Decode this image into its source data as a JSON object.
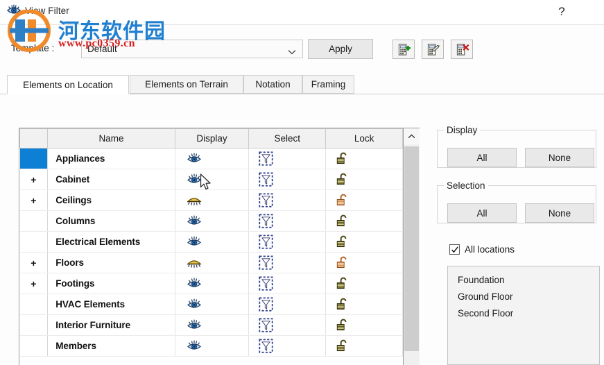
{
  "window": {
    "title": "View Filter",
    "help_label": "?",
    "title_icon": "eye-icon"
  },
  "watermark": {
    "cn_text": "河东软件园",
    "url_text": "www.pc0359.cn"
  },
  "template_row": {
    "label": "Template :",
    "value": "Default",
    "apply_label": "Apply",
    "tools": [
      {
        "name": "new-template-icon",
        "tip": "New"
      },
      {
        "name": "edit-template-icon",
        "tip": "Edit"
      },
      {
        "name": "delete-template-icon",
        "tip": "Delete"
      }
    ]
  },
  "tabs": [
    {
      "label": "Elements on Location",
      "active": true
    },
    {
      "label": "Elements on Terrain",
      "active": false
    },
    {
      "label": "Notation",
      "active": false
    },
    {
      "label": "Framing",
      "active": false
    }
  ],
  "table": {
    "columns": [
      "",
      "Name",
      "Display",
      "Select",
      "Lock"
    ],
    "rows": [
      {
        "expand": "",
        "name": "Appliances",
        "selected": true,
        "display": "eye-open",
        "select": "filter-marquee",
        "lock": "lock-open-dark"
      },
      {
        "expand": "+",
        "name": "Cabinet",
        "selected": false,
        "display": "eye-open",
        "select": "filter-marquee",
        "lock": "lock-open-dark"
      },
      {
        "expand": "+",
        "name": "Ceilings",
        "selected": false,
        "display": "eye-closed",
        "select": "filter-marquee",
        "lock": "lock-open-orange"
      },
      {
        "expand": "",
        "name": "Columns",
        "selected": false,
        "display": "eye-open",
        "select": "filter-marquee",
        "lock": "lock-open-dark"
      },
      {
        "expand": "",
        "name": "Electrical Elements",
        "selected": false,
        "display": "eye-open",
        "select": "filter-marquee",
        "lock": "lock-open-dark"
      },
      {
        "expand": "+",
        "name": "Floors",
        "selected": false,
        "display": "eye-closed",
        "select": "filter-marquee",
        "lock": "lock-open-orange"
      },
      {
        "expand": "+",
        "name": "Footings",
        "selected": false,
        "display": "eye-open",
        "select": "filter-marquee",
        "lock": "lock-open-dark"
      },
      {
        "expand": "",
        "name": "HVAC Elements",
        "selected": false,
        "display": "eye-open",
        "select": "filter-marquee",
        "lock": "lock-open-dark"
      },
      {
        "expand": "",
        "name": "Interior Furniture",
        "selected": false,
        "display": "eye-open",
        "select": "filter-marquee",
        "lock": "lock-open-dark"
      },
      {
        "expand": "",
        "name": "Members",
        "selected": false,
        "display": "eye-open",
        "select": "filter-marquee",
        "lock": "lock-open-dark"
      }
    ]
  },
  "side_panel": {
    "display_group": {
      "legend": "Display",
      "all_label": "All",
      "none_label": "None"
    },
    "selection_group": {
      "legend": "Selection",
      "all_label": "All",
      "none_label": "None"
    },
    "all_locations": {
      "label": "All locations",
      "checked": true
    },
    "locations": [
      "Foundation",
      "Ground Floor",
      "Second Floor"
    ]
  },
  "colors": {
    "selected_cell": "#0d7fd4",
    "accent_blue": "#1f7fd0",
    "watermark_red": "#d81e1e",
    "lock_dark": "#4f4a1c",
    "lock_orange": "#c87a3a"
  }
}
